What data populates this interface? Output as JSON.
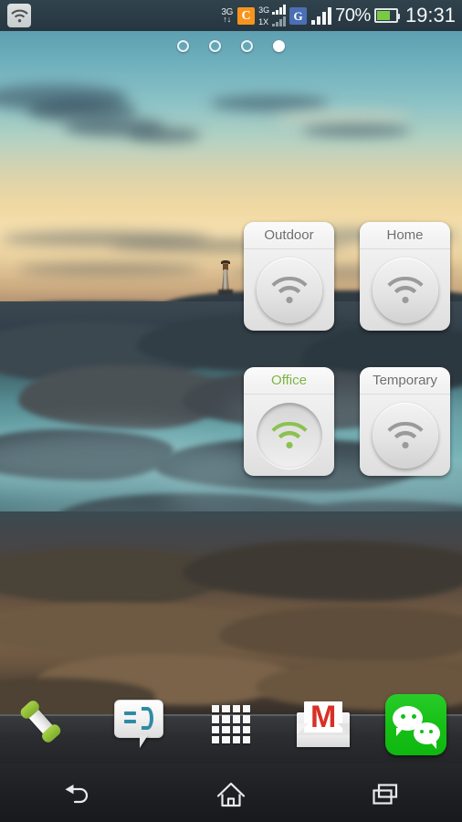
{
  "device": {
    "screen": "android-home-screen",
    "wallpaper_description": "coastal sunset with lighthouse, rocks and misty teal water"
  },
  "status_bar": {
    "wifi_icon": "wifi-icon",
    "network_left": {
      "label": "3G",
      "arrows": "↑↓"
    },
    "carrier_c": {
      "badge": "C",
      "rows": [
        "3G",
        "1X"
      ]
    },
    "carrier_g": {
      "badge": "G"
    },
    "battery": {
      "percent_label": "70%",
      "level": 70,
      "color": "#7ac943"
    },
    "clock": "19:31"
  },
  "page_indicator": {
    "count": 4,
    "active_index": 3
  },
  "widget": {
    "name": "wifi-profile-switcher",
    "active_color": "#7cb342",
    "inactive_color": "#6e6e6e",
    "tiles": [
      {
        "label": "Outdoor",
        "state": "off",
        "icon": "wifi-icon"
      },
      {
        "label": "Home",
        "state": "off",
        "icon": "wifi-icon"
      },
      {
        "label": "Office",
        "state": "on",
        "icon": "wifi-icon"
      },
      {
        "label": "Temporary",
        "state": "off",
        "icon": "wifi-icon"
      }
    ]
  },
  "dock": {
    "items": [
      {
        "name": "phone",
        "icon": "phone-handset-icon"
      },
      {
        "name": "messaging",
        "icon": "message-bubble-icon"
      },
      {
        "name": "app-drawer",
        "icon": "app-grid-icon"
      },
      {
        "name": "gmail",
        "icon": "gmail-envelope-icon",
        "glyph": "M"
      },
      {
        "name": "wechat",
        "icon": "wechat-bubbles-icon"
      }
    ]
  },
  "nav_bar": {
    "items": [
      {
        "name": "back",
        "icon": "back-arrow-icon"
      },
      {
        "name": "home",
        "icon": "home-icon"
      },
      {
        "name": "recents",
        "icon": "recents-icon"
      }
    ]
  }
}
